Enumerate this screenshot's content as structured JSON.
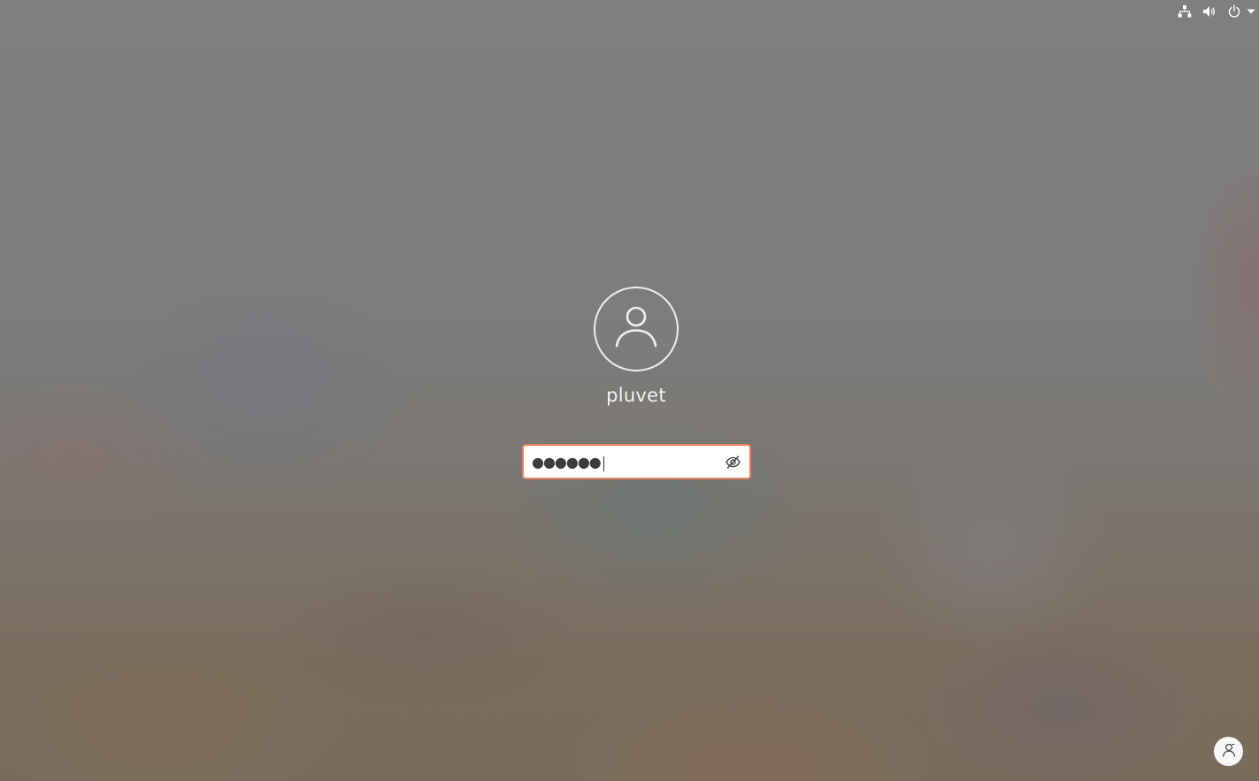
{
  "top_bar": {
    "icons": [
      "network-icon",
      "volume-icon",
      "power-icon",
      "system-menu-arrow-icon"
    ]
  },
  "login": {
    "avatar_icon": "user-avatar-icon",
    "username": "pluvet",
    "password_masked": "●●●●●●",
    "reveal_icon": "eye-slash-icon"
  },
  "bottom": {
    "switch_user_icon": "switch-user-icon"
  },
  "colors": {
    "focus_ring": "#e9835e",
    "text_light": "#f4f4f4"
  }
}
